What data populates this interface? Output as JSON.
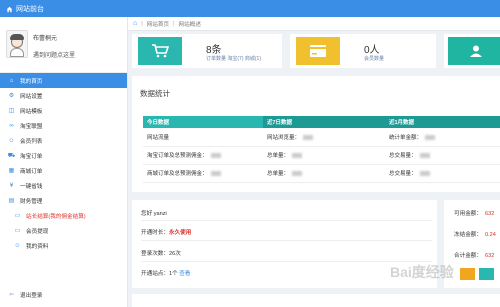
{
  "topbar": {
    "title": "网站前台"
  },
  "profile": {
    "name": "布蕾桐元",
    "subtitle": "遇到问题点这里"
  },
  "nav": {
    "items": [
      {
        "label": "我的首页",
        "icon": "home-icon",
        "glyph": "⌂",
        "active": true
      },
      {
        "label": "网站设置",
        "icon": "gear-icon",
        "glyph": "⚙"
      },
      {
        "label": "网站模板",
        "icon": "template-icon",
        "glyph": "◫"
      },
      {
        "label": "淘宝联盟",
        "icon": "link-icon",
        "glyph": "∞"
      },
      {
        "label": "会员列表",
        "icon": "users-icon",
        "glyph": "☺"
      },
      {
        "label": "淘宝订单",
        "icon": "cart-icon",
        "glyph": "⛟"
      },
      {
        "label": "商城订单",
        "icon": "order-icon",
        "glyph": "▦"
      },
      {
        "label": "一键省钱",
        "icon": "money-icon",
        "glyph": "¥"
      },
      {
        "label": "财务管理",
        "icon": "finance-icon",
        "glyph": "▤"
      }
    ],
    "sub_items": [
      {
        "label": "站长结算(我的佣金结算)",
        "icon": "settle-icon",
        "glyph": "▭"
      },
      {
        "label": "会员提现",
        "icon": "withdraw-icon",
        "glyph": "▭"
      },
      {
        "label": "我的资料",
        "icon": "profile-icon",
        "glyph": "☺"
      }
    ],
    "logout": "退出登录"
  },
  "breadcrumb": {
    "home": "网站首页",
    "current": "网站概述"
  },
  "stats": [
    {
      "value": "8条",
      "sub": "订单数量 淘宝(7) 商城(1)",
      "icon": "cart-icon"
    },
    {
      "value": "0人",
      "sub": "会员数量",
      "icon": "card-icon"
    },
    {
      "value": "",
      "sub": "",
      "icon": "user-icon"
    }
  ],
  "data_panel": {
    "title": "数据统计",
    "headers": [
      "今日数据",
      "近7日数据",
      "近1月数据"
    ],
    "rows": [
      [
        "网站流量",
        "网站浏览量：",
        "统计单金额："
      ],
      [
        "淘宝订单及总预测佣金：",
        "总单量：",
        "总交易量："
      ],
      [
        "商城订单及总预测佣金：",
        "总单量：",
        "总交易量："
      ]
    ]
  },
  "account": {
    "greeting": "您好 yanzi",
    "open_time_label": "开通时长：",
    "open_time_value": "永久使用",
    "login_count": "登录次数：26次",
    "sites_prefix": "开通站点：1个",
    "sites_link": "查看"
  },
  "money": {
    "available": "可用金额：",
    "available_val": "632",
    "frozen": "冻结金额：",
    "frozen_val": "0.24",
    "total": "合计金额：",
    "total_val": "632"
  },
  "watermark": "Bai度经验",
  "colors": {
    "primary": "#3a8ee6",
    "teal": "#2ab7b0",
    "yellow": "#f0c02e",
    "red": "#d9322b"
  }
}
